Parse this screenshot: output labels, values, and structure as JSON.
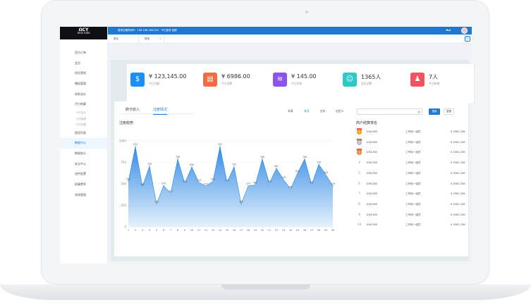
{
  "topbar": {
    "info": "登录日期时间IP：198.168.186.256",
    "lock": "IP已登录 锁屏",
    "username": "Hui"
  },
  "logo": {
    "mark": "ΩCY",
    "name": "mini kids"
  },
  "sidebar": {
    "items": [
      {
        "label": "室内订单",
        "sub": false,
        "active": false
      },
      {
        "label": "会员",
        "sub": false,
        "active": false
      },
      {
        "label": "短信营销",
        "sub": false,
        "active": false
      },
      {
        "label": "播报管理",
        "sub": false,
        "active": false
      },
      {
        "label": "收款流水",
        "sub": false,
        "active": false
      },
      {
        "label": "代付结算",
        "sub": false,
        "active": false
      },
      {
        "label": "代付流水",
        "sub": true,
        "active": false
      },
      {
        "label": "代付管理",
        "sub": true,
        "active": false
      },
      {
        "label": "代付设置",
        "sub": true,
        "active": false
      },
      {
        "label": "提现列表",
        "sub": false,
        "active": false
      },
      {
        "label": "数据中心",
        "sub": false,
        "active": true
      },
      {
        "label": "数据统计",
        "sub": false,
        "active": false
      },
      {
        "label": "安全中心",
        "sub": false,
        "active": false
      },
      {
        "label": "进件配置",
        "sub": false,
        "active": false
      },
      {
        "label": "结算费率",
        "sub": false,
        "active": false
      },
      {
        "label": "系统管理",
        "sub": false,
        "active": false
      }
    ]
  },
  "tabs": [
    {
      "label": "首页"
    },
    {
      "label": "提现",
      "close": "×"
    }
  ],
  "tabs_refresh": "↻",
  "stats": [
    {
      "value": "¥ 123,145.00",
      "label": "今日总额",
      "color": "#1a8ff7",
      "icon": "$"
    },
    {
      "value": "¥ 6986.00",
      "label": "今日消费",
      "color": "#f26b42",
      "icon": "▤"
    },
    {
      "value": "¥ 145.00",
      "label": "今日利润",
      "color": "#8c55e8",
      "icon": "≋"
    },
    {
      "value": "1365人",
      "label": "会员总数",
      "color": "#2ec8c8",
      "icon": "☺"
    },
    {
      "value": "7人",
      "label": "今日新增",
      "color": "#f4525e",
      "icon": "♟"
    }
  ],
  "panel": {
    "tabs": [
      "刷卡收入",
      "注册情况"
    ],
    "ranges": [
      "本周",
      "本月",
      "全年",
      "自定义"
    ],
    "date_icon": "▦",
    "search": "搜索",
    "reset": "重置",
    "chart_title": "注册趋势",
    "ranking_title": "商户结算排名"
  },
  "chart_data": {
    "type": "area",
    "x": [
      1,
      2,
      3,
      4,
      5,
      6,
      7,
      8,
      9,
      10,
      11,
      12,
      13,
      14,
      15,
      16,
      17,
      18,
      19,
      20,
      21,
      22,
      23,
      24,
      25,
      26,
      27,
      28,
      29,
      30
    ],
    "values": [
      529,
      934,
      468,
      706,
      265,
      479,
      391,
      788,
      506,
      696,
      516,
      473,
      529,
      935,
      518,
      700,
      265,
      475,
      487,
      788,
      506,
      681,
      549,
      440,
      624,
      788,
      491,
      726,
      606,
      476
    ],
    "yticks": [
      0,
      250,
      500,
      750,
      1000
    ],
    "ylim": [
      0,
      1000
    ],
    "color": "#1f78d1"
  },
  "ranking": [
    {
      "rank": "1",
      "code": "10KC365",
      "name": "工号鸡一组员",
      "amount": "¥ 3562.256",
      "medal": "#f0a21a"
    },
    {
      "rank": "2",
      "code": "10KC365",
      "name": "工号鸡一组员",
      "amount": "¥ 3562.256",
      "medal": "#b3bcc5"
    },
    {
      "rank": "3",
      "code": "10KC365",
      "name": "工号鸡一组员",
      "amount": "¥ 3562.256",
      "medal": "#e6883e"
    },
    {
      "rank": "4",
      "code": "10KC365",
      "name": "工号鸡一组员",
      "amount": "¥ 3562.256"
    },
    {
      "rank": "5",
      "code": "10KC365",
      "name": "工号鸡一组员",
      "amount": "¥ 3562.256"
    },
    {
      "rank": "6",
      "code": "10KC365",
      "name": "工号鸡一组员",
      "amount": "¥ 3562.256"
    },
    {
      "rank": "7",
      "code": "10KC365",
      "name": "工号鸡一组员",
      "amount": "¥ 3562.256"
    },
    {
      "rank": "8",
      "code": "10KC365",
      "name": "工号鸡一组员",
      "amount": "¥ 3562.256"
    },
    {
      "rank": "9",
      "code": "10KC365",
      "name": "工号鸡一组员",
      "amount": "¥ 3562.256"
    },
    {
      "rank": "10",
      "code": "10KC365",
      "name": "工号鸡一组员",
      "amount": "¥ 3562.256"
    }
  ]
}
